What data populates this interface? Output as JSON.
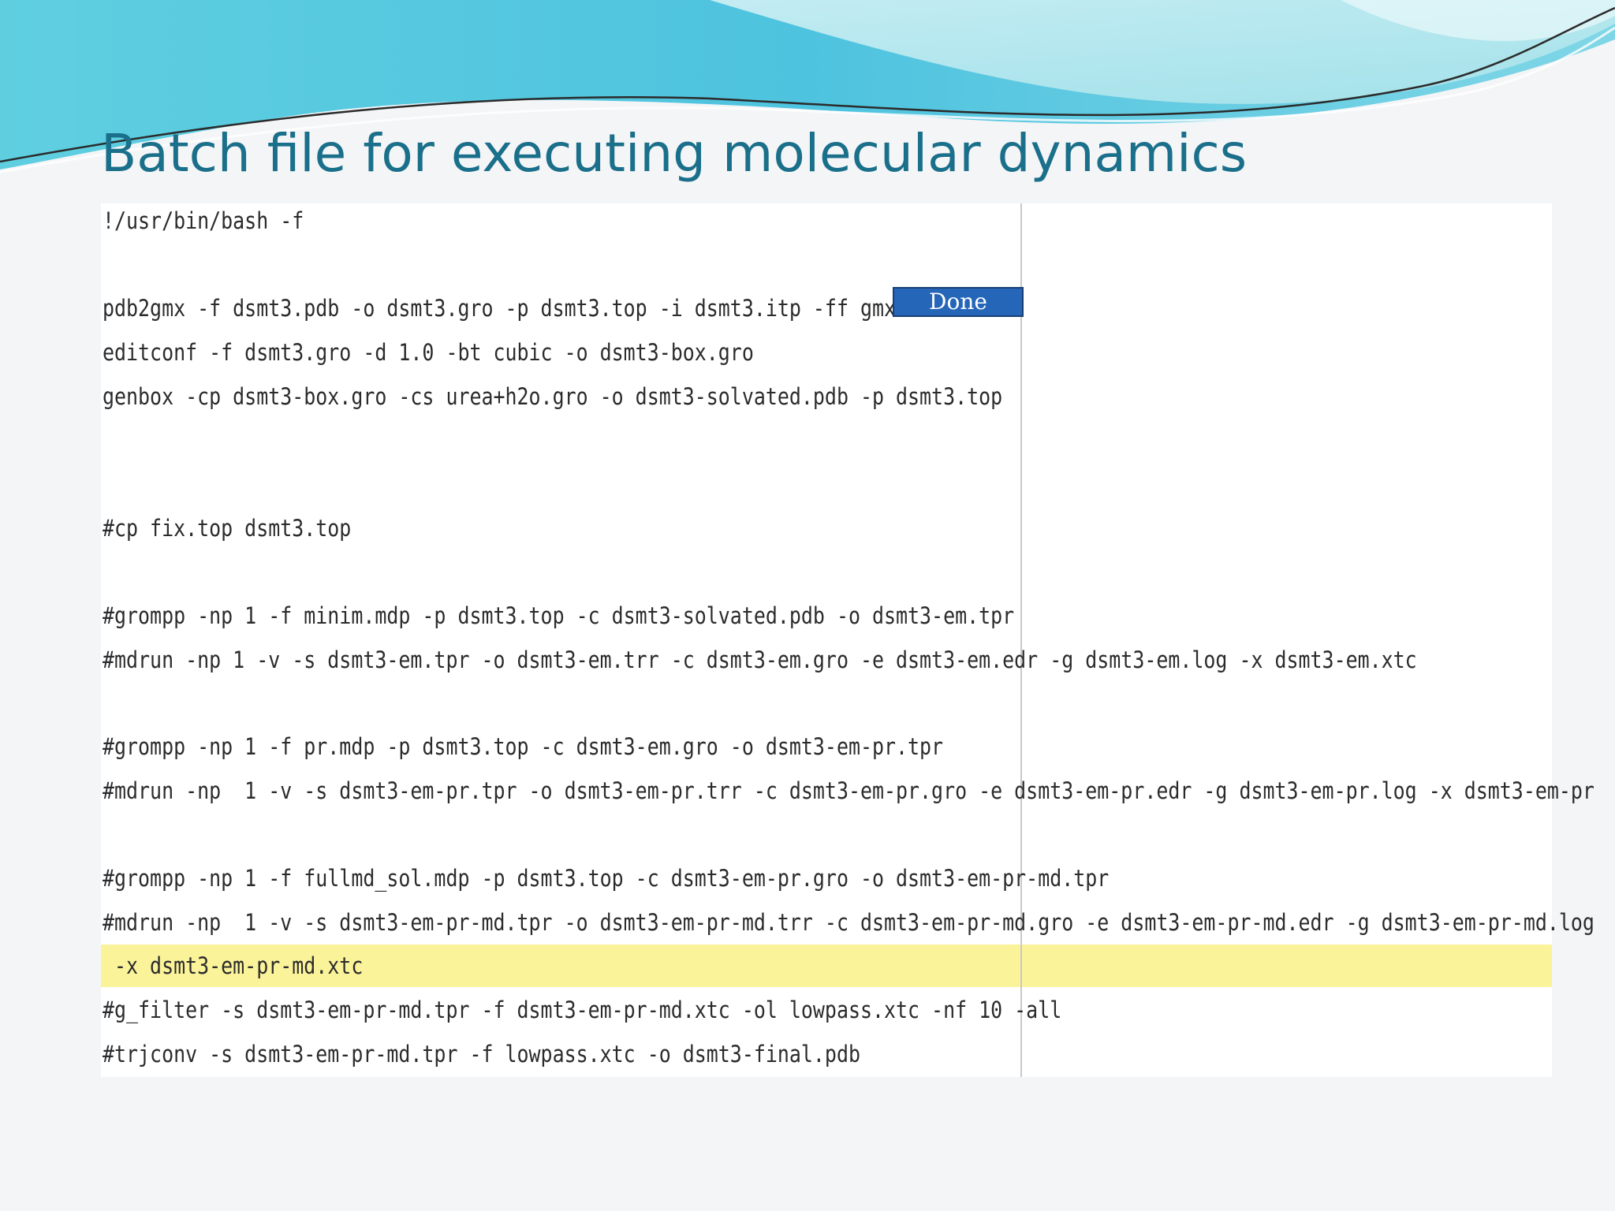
{
  "slide": {
    "title": "Batch file for executing molecular dynamics"
  },
  "button": {
    "done_label": "Done"
  },
  "highlight_color": "#fbf39a",
  "accent_color": "#1a6f8a",
  "code_lines": [
    "!/usr/bin/bash -f",
    "pdb2gmx -f dsmt3.pdb -o dsmt3.gro -p dsmt3.top -i dsmt3.itp -ff gmx",
    "editconf -f dsmt3.gro -d 1.0 -bt cubic -o dsmt3-box.gro",
    "genbox -cp dsmt3-box.gro -cs urea+h2o.gro -o dsmt3-solvated.pdb -p dsmt3.top",
    "#cp fix.top dsmt3.top",
    "#grompp -np 1 -f minim.mdp -p dsmt3.top -c dsmt3-solvated.pdb -o dsmt3-em.tpr",
    "#mdrun -np 1 -v -s dsmt3-em.tpr -o dsmt3-em.trr -c dsmt3-em.gro -e dsmt3-em.edr -g dsmt3-em.log -x dsmt3-em.xtc",
    "#grompp -np 1 -f pr.mdp -p dsmt3.top -c dsmt3-em.gro -o dsmt3-em-pr.tpr",
    "#mdrun -np  1 -v -s dsmt3-em-pr.tpr -o dsmt3-em-pr.trr -c dsmt3-em-pr.gro -e dsmt3-em-pr.edr -g dsmt3-em-pr.log -x dsmt3-em-pr",
    "#grompp -np 1 -f fullmd_sol.mdp -p dsmt3.top -c dsmt3-em-pr.gro -o dsmt3-em-pr-md.tpr",
    "#mdrun -np  1 -v -s dsmt3-em-pr-md.tpr -o dsmt3-em-pr-md.trr -c dsmt3-em-pr-md.gro -e dsmt3-em-pr-md.edr -g dsmt3-em-pr-md.log",
    " -x dsmt3-em-pr-md.xtc",
    "#g_filter -s dsmt3-em-pr-md.tpr -f dsmt3-em-pr-md.xtc -ol lowpass.xtc -nf 10 -all",
    "#trjconv -s dsmt3-em-pr-md.tpr -f lowpass.xtc -o dsmt3-final.pdb"
  ]
}
